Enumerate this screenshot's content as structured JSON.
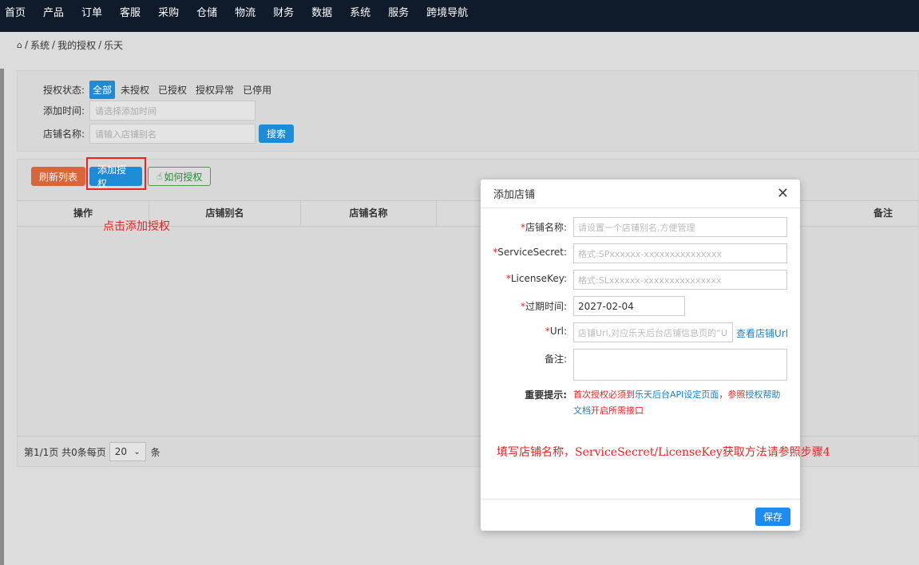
{
  "nav": [
    "首页",
    "产品",
    "订单",
    "客服",
    "采购",
    "仓储",
    "物流",
    "财务",
    "数据",
    "系统",
    "服务",
    "跨境导航"
  ],
  "breadcrumb": {
    "home_icon": "home-icon",
    "items": [
      "系统",
      "我的授权",
      "乐天"
    ],
    "sep": "/"
  },
  "filter": {
    "status_label": "授权状态:",
    "status_options": [
      "全部",
      "未授权",
      "已授权",
      "授权异常",
      "已停用"
    ],
    "time_label": "添加时间:",
    "time_placeholder": "请选择添加时间",
    "shop_label": "店铺名称:",
    "shop_placeholder": "请输入店铺别名",
    "search_button": "搜索"
  },
  "toolbar": {
    "refresh": "刷新列表",
    "add": "添加授权",
    "howto": "如何授权"
  },
  "table": {
    "columns": [
      "操作",
      "店铺别名",
      "店铺名称",
      "备注"
    ]
  },
  "pager": {
    "info": "第1/1页 共0条每页",
    "page_size": "20",
    "unit": "条"
  },
  "annotations": {
    "click_add": "点击添加授权",
    "fill_hint": "填写店铺名称，ServiceSecret/LicenseKey获取方法请参照步骤4"
  },
  "modal": {
    "title": "添加店铺",
    "fields": {
      "shop_name": {
        "label": "店铺名称:",
        "placeholder": "请设置一个店铺别名,方便管理"
      },
      "service_secret": {
        "label": "ServiceSecret:",
        "placeholder": "格式:SPxxxxxx-xxxxxxxxxxxxxxx"
      },
      "license_key": {
        "label": "LicenseKey:",
        "placeholder": "格式:SLxxxxxx-xxxxxxxxxxxxxxx"
      },
      "expire": {
        "label": "过期时间:",
        "value": "2027-02-04"
      },
      "url": {
        "label": "Url:",
        "placeholder": "店铺Url,对应乐天后台店铺信息页的“U",
        "link": "查看店铺Url"
      },
      "remark": {
        "label": "备注:"
      }
    },
    "tip_label": "重要提示:",
    "tip_parts": [
      "首次授权必须到",
      "乐天后台API设定页面",
      "，参照",
      "授权帮助文档",
      "开启所需接口"
    ],
    "save": "保存",
    "required_mark": "*"
  }
}
